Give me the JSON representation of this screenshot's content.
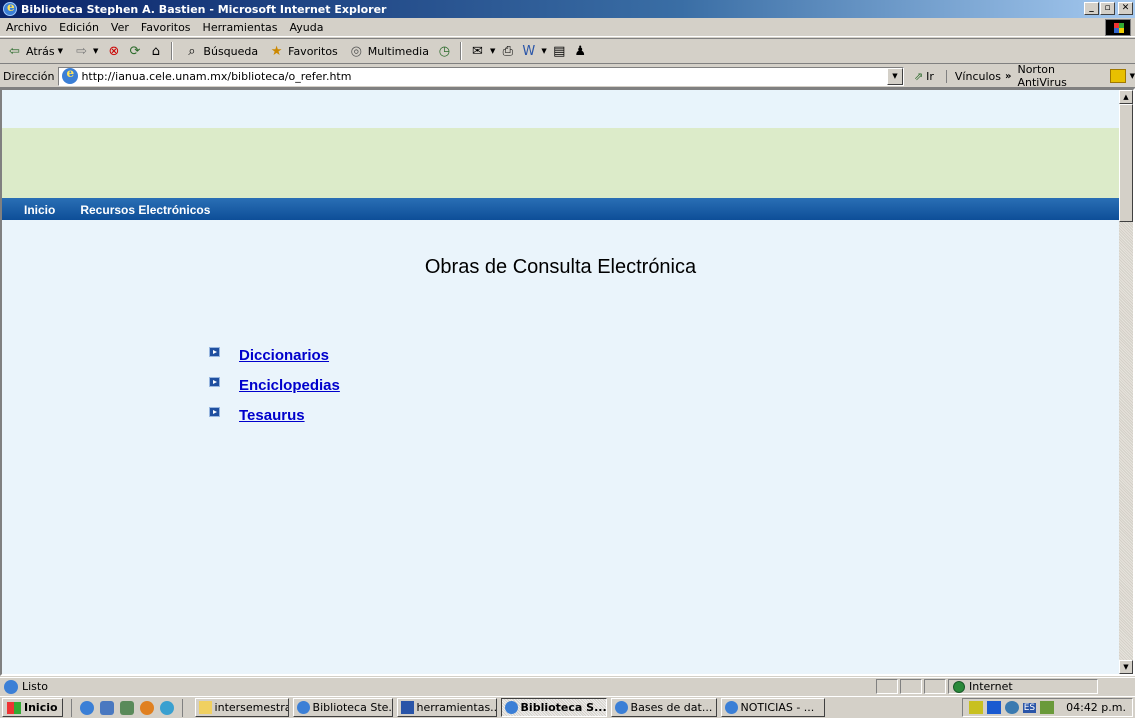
{
  "window": {
    "title": "Biblioteca Stephen A. Bastien - Microsoft Internet Explorer"
  },
  "menu": [
    "Archivo",
    "Edición",
    "Ver",
    "Favoritos",
    "Herramientas",
    "Ayuda"
  ],
  "toolbar": {
    "back": "Atrás",
    "search": "Búsqueda",
    "favorites": "Favoritos",
    "media": "Multimedia"
  },
  "address": {
    "label": "Dirección",
    "url": "http://ianua.cele.unam.mx/biblioteca/o_refer.htm",
    "go": "Ir",
    "links": "Vínculos",
    "norton": "Norton AntiVirus"
  },
  "page": {
    "nav": [
      "Inicio",
      "Recursos Electrónicos"
    ],
    "title": "Obras de Consulta Electrónica",
    "links": [
      "Diccionarios",
      "Enciclopedias",
      "Tesaurus"
    ]
  },
  "status": {
    "text": "Listo",
    "zone": "Internet"
  },
  "taskbar": {
    "start": "Inicio",
    "tasks": [
      "intersemestral",
      "Biblioteca Ste...",
      "herramientas...",
      "Biblioteca S...",
      "Bases de dat...",
      "NOTICIAS - ..."
    ],
    "lang": "ES",
    "clock": "04:42 p.m."
  }
}
